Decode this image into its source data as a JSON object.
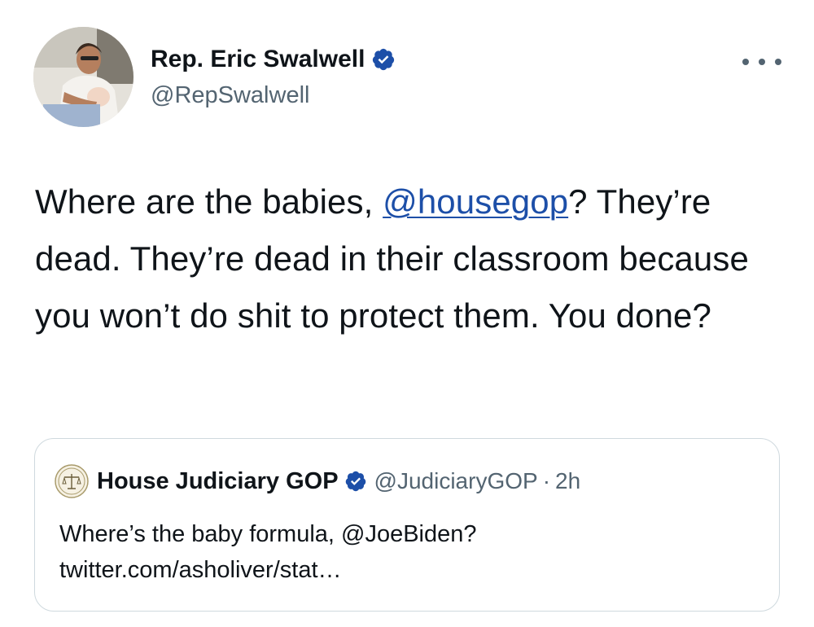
{
  "author": {
    "display_name": "Rep. Eric Swalwell",
    "handle": "@RepSwalwell",
    "verified": true,
    "avatar_icon": "profile-photo"
  },
  "more_icon": "more-horizontal-icon",
  "tweet": {
    "text_before": "Where are the babies, ",
    "mention": "@housegop",
    "text_after": "? They’re dead. They’re dead in their classroom because you won’t do shit to protect them. You done?"
  },
  "quoted_tweet": {
    "display_name": "House Judiciary GOP",
    "handle": "@JudiciaryGOP",
    "separator": "·",
    "time": "2h",
    "verified": true,
    "avatar_icon": "scales-of-justice-seal",
    "text": "Where’s the baby formula, @JoeBiden? twitter.com/asholiver/stat…"
  },
  "colors": {
    "verified_badge": "#1d4fa8",
    "mention_link": "#1d4fa8",
    "secondary_text": "#536471",
    "card_border": "#cfd9de"
  }
}
